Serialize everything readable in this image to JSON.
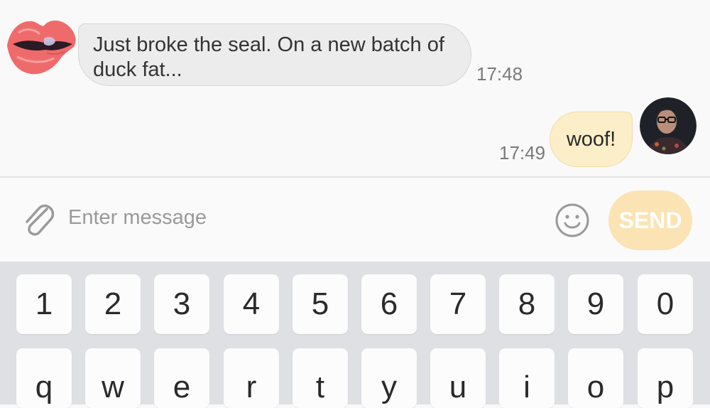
{
  "conversation": {
    "messages": [
      {
        "direction": "incoming",
        "avatar_icon": "lips-kiss-avatar",
        "text_line1": "Just broke the seal. On a new batch of",
        "text_line2": "duck fat...",
        "time": "17:48"
      },
      {
        "direction": "outgoing",
        "avatar_icon": "user-photo-avatar",
        "text": "woof!",
        "time": "17:49"
      }
    ]
  },
  "composer": {
    "placeholder": "Enter message",
    "value": "",
    "attach_icon": "paperclip-icon",
    "emoji_icon": "smiley-icon",
    "send_label": "SEND"
  },
  "keyboard": {
    "number_row": [
      "1",
      "2",
      "3",
      "4",
      "5",
      "6",
      "7",
      "8",
      "9",
      "0"
    ],
    "letter_row": [
      "q",
      "w",
      "e",
      "r",
      "t",
      "y",
      "u",
      "i",
      "o",
      "p"
    ]
  },
  "colors": {
    "incoming_bubble": "#ececec",
    "outgoing_bubble": "#fbeec8",
    "send_button": "#fbe3b3",
    "keyboard_bg": "#dfe0e4"
  }
}
